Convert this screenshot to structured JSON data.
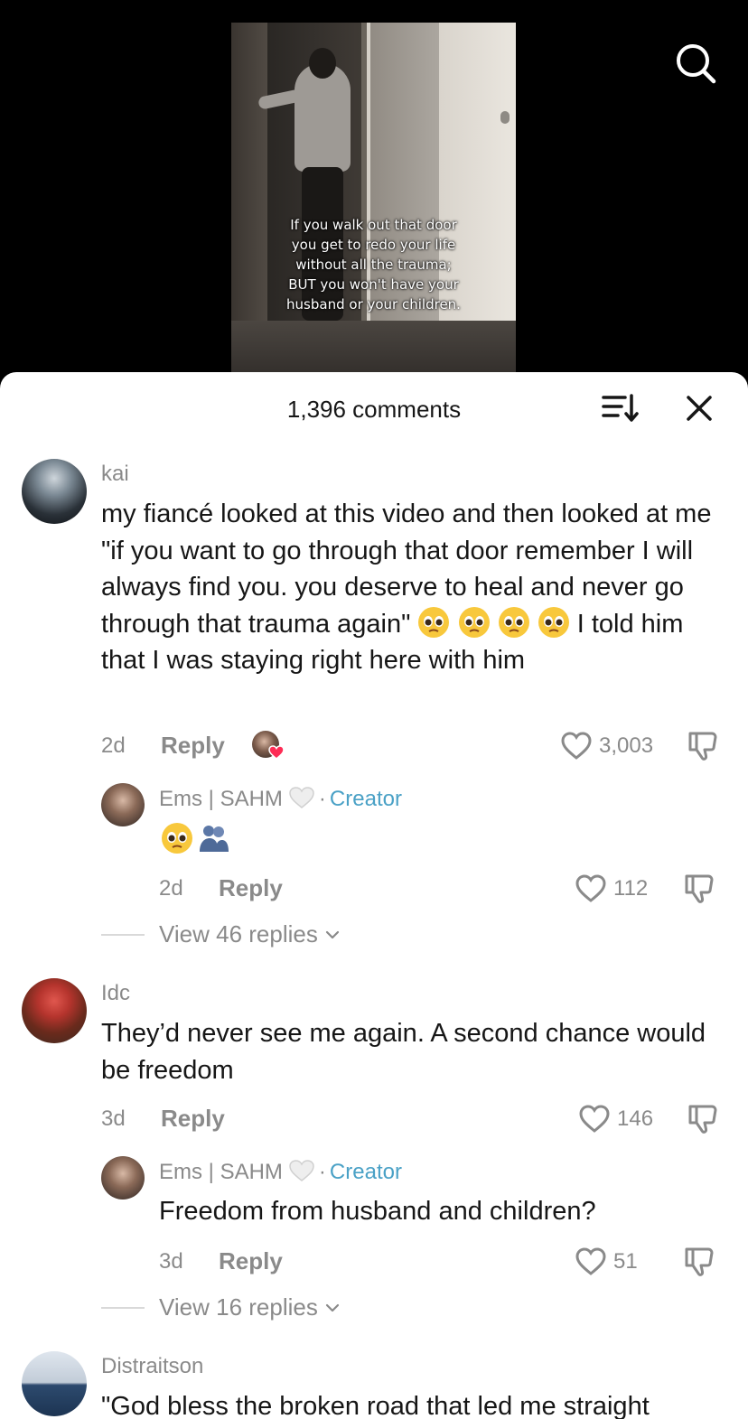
{
  "video": {
    "caption": "If you walk out that door\nyou get to redo your life\nwithout all the trauma;\nBUT you won't have your\nhusband or your children."
  },
  "header": {
    "comment_count": "1,396 comments"
  },
  "comments": [
    {
      "username": "kai",
      "text_part1": "my fiancé looked at this video and then looked at me \"if you want to go through that door remember I will always find you. you deserve to heal and never go through that trauma again\"",
      "text_part2": "I told him that I was staying right here with him",
      "age": "2d",
      "reply_label": "Reply",
      "likes": "3,003",
      "reply": {
        "username": "Ems | SAHM",
        "creator_label": "Creator",
        "age": "2d",
        "reply_label": "Reply",
        "likes": "112"
      },
      "view_replies": "View 46 replies"
    },
    {
      "username": "Idc",
      "text": "They’d never see me again. A second chance would be freedom",
      "age": "3d",
      "reply_label": "Reply",
      "likes": "146",
      "reply": {
        "username": "Ems | SAHM",
        "creator_label": "Creator",
        "text": "Freedom from husband and children?",
        "age": "3d",
        "reply_label": "Reply",
        "likes": "51"
      },
      "view_replies": "View 16 replies"
    },
    {
      "username": "Distraitson",
      "text": "\"God bless the broken road that led me straight"
    }
  ],
  "icons": {
    "search": "search-icon",
    "sort": "sort-icon",
    "close": "close-icon",
    "like": "heart-outline-icon",
    "dislike": "thumbs-down-icon",
    "chevron": "chevron-down-icon"
  },
  "colors": {
    "creator": "#4aa1c6",
    "muted": "#8a8a8a",
    "text": "#161616"
  }
}
